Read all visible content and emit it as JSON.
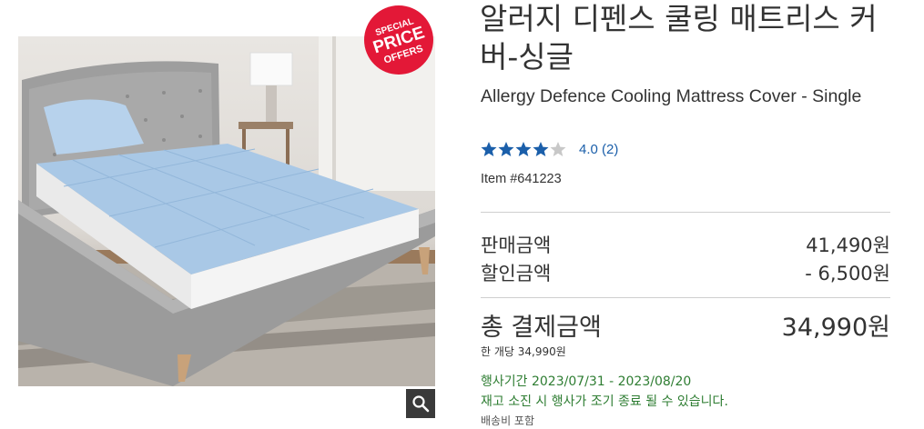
{
  "product": {
    "title_ko": "알러지 디펜스 쿨링 매트리스 커버-싱글",
    "title_en": "Allergy Defence Cooling Mattress Cover - Single",
    "rating": 4.0,
    "rating_label": "4.0 (2)",
    "item_number": "Item #641223",
    "image_alt": "Light blue quilted mattress cover on a grey upholstered bed"
  },
  "badge": {
    "line1": "SPECIAL",
    "line2": "PRICE",
    "line3": "OFFERS",
    "color": "#e31837"
  },
  "pricing": {
    "sale_label": "판매금액",
    "sale_value": "41,490원",
    "discount_label": "할인금액",
    "discount_value": "- 6,500원",
    "total_label": "총 결제금액",
    "total_value": "34,990원",
    "unit_price": "한 개당 34,990원"
  },
  "promo": {
    "period": "행사기간 2023/07/31 - 2023/08/20",
    "note": "재고 소진 시 행사가 조기 종료 될 수 있습니다.",
    "color": "#2e7d32"
  },
  "shipping": {
    "note": "배송비 포함"
  },
  "colors": {
    "star": "#1b5faa",
    "star_empty": "#c8c8c8",
    "link": "#1b5faa"
  },
  "icons": {
    "zoom": "magnifier-icon",
    "star": "star-icon"
  }
}
